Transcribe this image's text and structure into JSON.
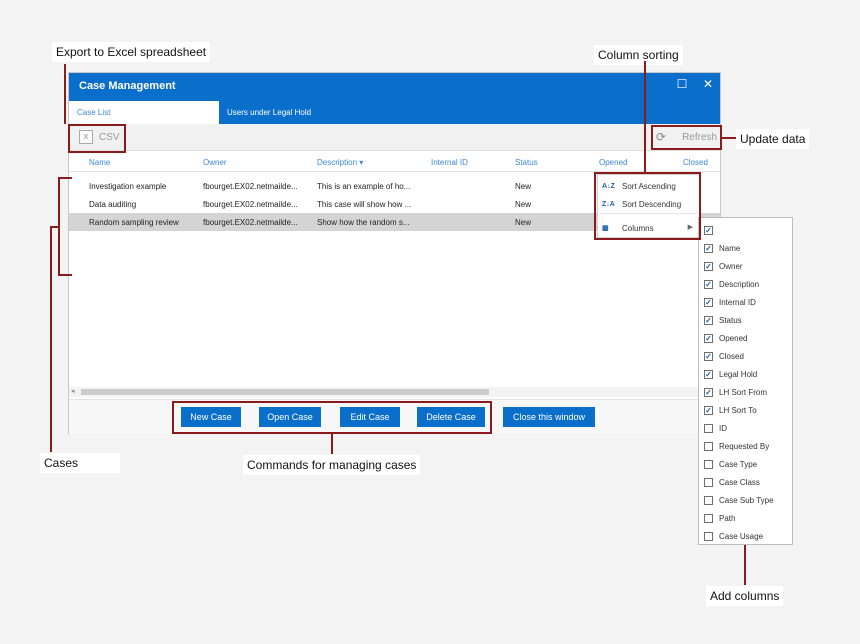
{
  "window": {
    "title": "Case Management",
    "maximize_glyph": "☐",
    "close_glyph": "✕",
    "tabs": [
      {
        "label": "Case List",
        "active": true
      },
      {
        "label": "Users under Legal Hold",
        "active": false
      }
    ]
  },
  "toolbar": {
    "csv_label": "CSV",
    "csv_icon": "excel-icon",
    "refresh_label": "Refresh",
    "refresh_icon": "refresh-icon"
  },
  "grid": {
    "columns": [
      "Name",
      "Owner",
      "Description ▾",
      "Internal ID",
      "Status",
      "Opened",
      "Closed"
    ],
    "rows": [
      {
        "name": "Investigation example",
        "owner": "fbourget.EX02.netmailde...",
        "description": "This is an example of ho...",
        "status": "New",
        "selected": false
      },
      {
        "name": "Data auditing",
        "owner": "fbourget.EX02.netmailde...",
        "description": "This case will show how ...",
        "status": "New",
        "selected": false
      },
      {
        "name": "Random sampling review",
        "owner": "fbourget.EX02.netmailde...",
        "description": "Show how the random s...",
        "status": "New",
        "selected": true
      }
    ],
    "scroll_left_glyph": "◂"
  },
  "buttons": {
    "new_case": "New Case",
    "open_case": "Open Case",
    "edit_case": "Edit Case",
    "delete_case": "Delete Case",
    "close_window": "Close this window"
  },
  "sort_menu": {
    "ascending": "Sort Ascending",
    "descending": "Sort Descending",
    "columns": "Columns",
    "ascending_glyph": "A↓Z",
    "descending_glyph": "Z↓A",
    "columns_glyph": "▦",
    "submenu_glyph": "▶"
  },
  "columns_list": [
    {
      "label": "",
      "checked": true
    },
    {
      "label": "Name",
      "checked": true
    },
    {
      "label": "Owner",
      "checked": true
    },
    {
      "label": "Description",
      "checked": true
    },
    {
      "label": "Internal ID",
      "checked": true
    },
    {
      "label": "Status",
      "checked": true
    },
    {
      "label": "Opened",
      "checked": true
    },
    {
      "label": "Closed",
      "checked": true
    },
    {
      "label": "Legal Hold",
      "checked": true
    },
    {
      "label": "LH Sort From",
      "checked": true
    },
    {
      "label": "LH Sort To",
      "checked": true
    },
    {
      "label": "ID",
      "checked": false
    },
    {
      "label": "Requested By",
      "checked": false
    },
    {
      "label": "Case Type",
      "checked": false
    },
    {
      "label": "Case Class",
      "checked": false
    },
    {
      "label": "Case Sub Type",
      "checked": false
    },
    {
      "label": "Path",
      "checked": false
    },
    {
      "label": "Case Usage",
      "checked": false
    }
  ],
  "annotations": {
    "export": "Export to Excel spreadsheet",
    "sorting": "Column sorting",
    "update": "Update data",
    "cases": "Cases",
    "commands": "Commands for managing cases",
    "add_columns": "Add columns"
  },
  "colors": {
    "accent": "#0a6ecb",
    "annotation": "#8b1a1a",
    "selected_row": "#d4d4d4"
  }
}
